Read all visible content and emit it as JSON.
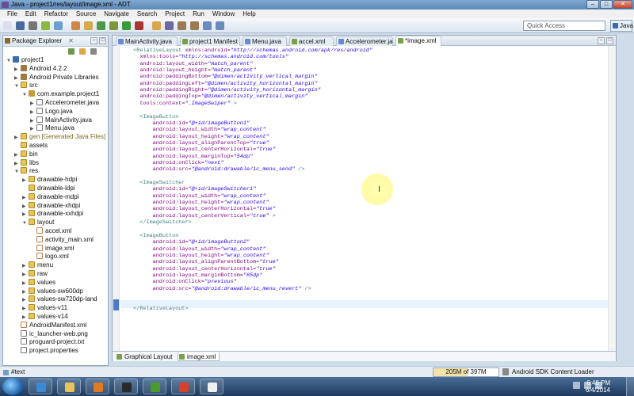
{
  "window": {
    "title": "Java - project1/res/layout/image.xml - ADT",
    "buttons": [
      "–",
      "□",
      "✕"
    ]
  },
  "menu": [
    "File",
    "Edit",
    "Refactor",
    "Source",
    "Navigate",
    "Search",
    "Project",
    "Run",
    "Window",
    "Help"
  ],
  "toolbar": {
    "quick_access_placeholder": "Quick Access",
    "perspective_label": "Java"
  },
  "package_explorer": {
    "title": "Package Explorer",
    "close": "✕",
    "tree": [
      {
        "label": "project1",
        "depth": 0,
        "icon": "proj",
        "arrow": "▼"
      },
      {
        "label": "Android 4.2.2",
        "depth": 1,
        "icon": "lib",
        "arrow": "▶"
      },
      {
        "label": "Android Private Libraries",
        "depth": 1,
        "icon": "lib",
        "arrow": "▶"
      },
      {
        "label": "src",
        "depth": 1,
        "icon": "fold",
        "arrow": "▼"
      },
      {
        "label": "com.example.project1",
        "depth": 2,
        "icon": "pkg",
        "arrow": "▼"
      },
      {
        "label": "Accelerometer.java",
        "depth": 3,
        "icon": "jfile",
        "arrow": "▶"
      },
      {
        "label": "Logo.java",
        "depth": 3,
        "icon": "jfile",
        "arrow": "▶"
      },
      {
        "label": "MainActivity.java",
        "depth": 3,
        "icon": "jfile",
        "arrow": "▶"
      },
      {
        "label": "Menu.java",
        "depth": 3,
        "icon": "jfile",
        "arrow": "▶"
      },
      {
        "label": "gen [Generated Java Files]",
        "depth": 1,
        "icon": "fold",
        "arrow": "▶",
        "gen": true
      },
      {
        "label": "assets",
        "depth": 1,
        "icon": "fold",
        "arrow": ""
      },
      {
        "label": "bin",
        "depth": 1,
        "icon": "fold",
        "arrow": "▶"
      },
      {
        "label": "libs",
        "depth": 1,
        "icon": "fold",
        "arrow": "▶"
      },
      {
        "label": "res",
        "depth": 1,
        "icon": "fold",
        "arrow": "▼"
      },
      {
        "label": "drawable-hdpi",
        "depth": 2,
        "icon": "fold",
        "arrow": "▶"
      },
      {
        "label": "drawable-ldpi",
        "depth": 2,
        "icon": "fold",
        "arrow": ""
      },
      {
        "label": "drawable-mdpi",
        "depth": 2,
        "icon": "fold",
        "arrow": "▶"
      },
      {
        "label": "drawable-xhdpi",
        "depth": 2,
        "icon": "fold",
        "arrow": "▶"
      },
      {
        "label": "drawable-xxhdpi",
        "depth": 2,
        "icon": "fold",
        "arrow": "▶"
      },
      {
        "label": "layout",
        "depth": 2,
        "icon": "fold",
        "arrow": "▼"
      },
      {
        "label": "accel.xml",
        "depth": 3,
        "icon": "xfile",
        "arrow": ""
      },
      {
        "label": "activity_main.xml",
        "depth": 3,
        "icon": "xfile",
        "arrow": ""
      },
      {
        "label": "image.xml",
        "depth": 3,
        "icon": "xfile",
        "arrow": ""
      },
      {
        "label": "logo.xml",
        "depth": 3,
        "icon": "xfile",
        "arrow": ""
      },
      {
        "label": "menu",
        "depth": 2,
        "icon": "fold",
        "arrow": "▶"
      },
      {
        "label": "raw",
        "depth": 2,
        "icon": "fold",
        "arrow": "▶"
      },
      {
        "label": "values",
        "depth": 2,
        "icon": "fold",
        "arrow": "▶"
      },
      {
        "label": "values-sw600dp",
        "depth": 2,
        "icon": "fold",
        "arrow": "▶"
      },
      {
        "label": "values-sw720dp-land",
        "depth": 2,
        "icon": "fold",
        "arrow": "▶"
      },
      {
        "label": "values-v11",
        "depth": 2,
        "icon": "fold",
        "arrow": "▶"
      },
      {
        "label": "values-v14",
        "depth": 2,
        "icon": "fold",
        "arrow": "▶"
      },
      {
        "label": "AndroidManifest.xml",
        "depth": 1,
        "icon": "xfile",
        "arrow": ""
      },
      {
        "label": "ic_launcher-web.png",
        "depth": 1,
        "icon": "jfile",
        "arrow": ""
      },
      {
        "label": "proguard-project.txt",
        "depth": 1,
        "icon": "jfile",
        "arrow": ""
      },
      {
        "label": "project.properties",
        "depth": 1,
        "icon": "jfile",
        "arrow": ""
      }
    ]
  },
  "editor": {
    "tabs": [
      {
        "label": "MainActivity.java",
        "color": "#6a8ad0"
      },
      {
        "label": "project1 Manifest",
        "color": "#7aa04a"
      },
      {
        "label": "Menu.java",
        "color": "#6a8ad0"
      },
      {
        "label": "accel.xml",
        "color": "#7aa04a"
      },
      {
        "label": "Accelerometer.java",
        "color": "#6a8ad0"
      },
      {
        "label": "*image.xml",
        "color": "#7aa04a",
        "active": true
      }
    ],
    "code_lines": [
      [
        [
          "  ",
          ""
        ],
        [
          "<RelativeLayout ",
          "tg"
        ],
        [
          "xmlns:android=",
          "an"
        ],
        [
          "\"http://schemas.android.com/apk/res/android\"",
          "av"
        ]
      ],
      [
        [
          "    ",
          ""
        ],
        [
          "xmlns:tools=",
          "an"
        ],
        [
          "\"http://schemas.android.com/tools\"",
          "av"
        ]
      ],
      [
        [
          "    ",
          ""
        ],
        [
          "android:layout_width=",
          "an"
        ],
        [
          "\"match_parent\"",
          "av"
        ]
      ],
      [
        [
          "    ",
          ""
        ],
        [
          "android:layout_height=",
          "an"
        ],
        [
          "\"match_parent\"",
          "av"
        ]
      ],
      [
        [
          "    ",
          ""
        ],
        [
          "android:paddingBottom=",
          "an"
        ],
        [
          "\"@dimen/activity_vertical_margin\"",
          "av"
        ]
      ],
      [
        [
          "    ",
          ""
        ],
        [
          "android:paddingLeft=",
          "an"
        ],
        [
          "\"@dimen/activity_horizontal_margin\"",
          "av"
        ]
      ],
      [
        [
          "    ",
          ""
        ],
        [
          "android:paddingRight=",
          "an"
        ],
        [
          "\"@dimen/activity_horizontal_margin\"",
          "av"
        ]
      ],
      [
        [
          "    ",
          ""
        ],
        [
          "android:paddingTop=",
          "an"
        ],
        [
          "\"@dimen/activity_vertical_margin\"",
          "av"
        ]
      ],
      [
        [
          "    ",
          ""
        ],
        [
          "tools:context=",
          "an"
        ],
        [
          "\".ImageSwiper\"",
          "av"
        ],
        [
          " >",
          "tg"
        ]
      ],
      [
        [
          "",
          ""
        ]
      ],
      [
        [
          "    ",
          ""
        ],
        [
          "<ImageButton",
          "tg"
        ]
      ],
      [
        [
          "        ",
          ""
        ],
        [
          "android:id=",
          "an"
        ],
        [
          "\"@+id/imageButton1\"",
          "av"
        ]
      ],
      [
        [
          "        ",
          ""
        ],
        [
          "android:layout_width=",
          "an"
        ],
        [
          "\"wrap_content\"",
          "av"
        ]
      ],
      [
        [
          "        ",
          ""
        ],
        [
          "android:layout_height=",
          "an"
        ],
        [
          "\"wrap_content\"",
          "av"
        ]
      ],
      [
        [
          "        ",
          ""
        ],
        [
          "android:layout_alignParentTop=",
          "an"
        ],
        [
          "\"true\"",
          "av"
        ]
      ],
      [
        [
          "        ",
          ""
        ],
        [
          "android:layout_centerHorizontal=",
          "an"
        ],
        [
          "\"true\"",
          "av"
        ]
      ],
      [
        [
          "        ",
          ""
        ],
        [
          "android:layout_marginTop=",
          "an"
        ],
        [
          "\"54dp\"",
          "av"
        ]
      ],
      [
        [
          "        ",
          ""
        ],
        [
          "android:onClick=",
          "an"
        ],
        [
          "\"next\"",
          "av"
        ]
      ],
      [
        [
          "        ",
          ""
        ],
        [
          "android:src=",
          "an"
        ],
        [
          "\"@android:drawable/ic_menu_send\"",
          "av"
        ],
        [
          " />",
          "tg"
        ]
      ],
      [
        [
          "",
          ""
        ]
      ],
      [
        [
          "    ",
          ""
        ],
        [
          "<ImageSwitcher",
          "tg"
        ]
      ],
      [
        [
          "        ",
          ""
        ],
        [
          "android:id=",
          "an"
        ],
        [
          "\"@+id/imageSwitcher1\"",
          "av"
        ]
      ],
      [
        [
          "        ",
          ""
        ],
        [
          "android:layout_width=",
          "an"
        ],
        [
          "\"wrap_content\"",
          "av"
        ]
      ],
      [
        [
          "        ",
          ""
        ],
        [
          "android:layout_height=",
          "an"
        ],
        [
          "\"wrap_content\"",
          "av"
        ]
      ],
      [
        [
          "        ",
          ""
        ],
        [
          "android:layout_centerHorizontal=",
          "an"
        ],
        [
          "\"true\"",
          "av"
        ]
      ],
      [
        [
          "        ",
          ""
        ],
        [
          "android:layout_centerVertical=",
          "an"
        ],
        [
          "\"true\"",
          "av"
        ],
        [
          " >",
          "tg"
        ]
      ],
      [
        [
          "    ",
          ""
        ],
        [
          "</ImageSwitcher>",
          "tg"
        ]
      ],
      [
        [
          "",
          ""
        ]
      ],
      [
        [
          "    ",
          ""
        ],
        [
          "<ImageButton",
          "tg"
        ]
      ],
      [
        [
          "        ",
          ""
        ],
        [
          "android:id=",
          "an"
        ],
        [
          "\"@+id/imageButton2\"",
          "av"
        ]
      ],
      [
        [
          "        ",
          ""
        ],
        [
          "android:layout_width=",
          "an"
        ],
        [
          "\"wrap_content\"",
          "av"
        ]
      ],
      [
        [
          "        ",
          ""
        ],
        [
          "android:layout_height=",
          "an"
        ],
        [
          "\"wrap_content\"",
          "av"
        ]
      ],
      [
        [
          "        ",
          ""
        ],
        [
          "android:layout_alignParentBottom=",
          "an"
        ],
        [
          "\"true\"",
          "av"
        ]
      ],
      [
        [
          "        ",
          ""
        ],
        [
          "android:layout_centerHorizontal=",
          "an"
        ],
        [
          "\"true\"",
          "av"
        ]
      ],
      [
        [
          "        ",
          ""
        ],
        [
          "android:layout_marginBottom=",
          "an"
        ],
        [
          "\"85dp\"",
          "av"
        ]
      ],
      [
        [
          "        ",
          ""
        ],
        [
          "android:onClick=",
          "an"
        ],
        [
          "\"previous\"",
          "av"
        ]
      ],
      [
        [
          "        ",
          ""
        ],
        [
          "android:src=",
          "an"
        ],
        [
          "\"@android:drawable/ic_menu_revert\"",
          "av"
        ],
        [
          " />",
          "tg"
        ]
      ],
      [
        [
          "",
          ""
        ]
      ],
      [
        [
          "",
          ""
        ]
      ],
      [
        [
          "  ",
          ""
        ],
        [
          "</RelativeLayout>",
          "tg"
        ]
      ]
    ],
    "bottom_tabs": [
      "Graphical Layout",
      "image.xml"
    ]
  },
  "status": {
    "left": "#text",
    "memory": "205M of 397M",
    "memory_fraction": 0.52,
    "loader": "Android SDK Content Loader"
  },
  "taskbar": {
    "apps": [
      {
        "name": "ie-icon",
        "color": "#3a8ad8"
      },
      {
        "name": "explorer-icon",
        "color": "#e8c45a"
      },
      {
        "name": "media-player-icon",
        "color": "#e07a20"
      },
      {
        "name": "som-icon",
        "color": "#2a2a2a"
      },
      {
        "name": "eclipse-icon",
        "color": "#4a9a30"
      },
      {
        "name": "chrome-icon",
        "color": "#d8402a"
      },
      {
        "name": "notepad-icon",
        "color": "#f0f0f0"
      }
    ],
    "time": "6:48 PM",
    "date": "6/4/2014"
  }
}
